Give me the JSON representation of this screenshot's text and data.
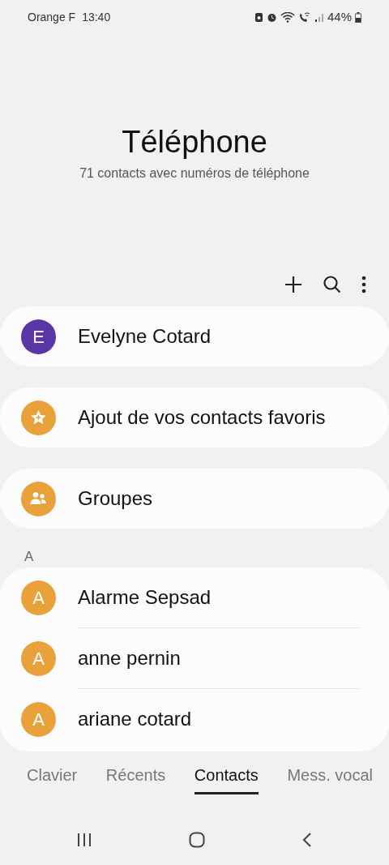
{
  "status_bar": {
    "carrier": "Orange F",
    "time": "13:40",
    "battery": "44%"
  },
  "header": {
    "title": "Téléphone",
    "subtitle": "71 contacts avec numéros de téléphone"
  },
  "profile": {
    "initial": "E",
    "name": "Evelyne Cotard",
    "color": "#5a36a6"
  },
  "shortcuts": [
    {
      "kind": "favorites",
      "label": "Ajout de vos contacts favoris",
      "color": "#e9a23b"
    },
    {
      "kind": "groups",
      "label": "Groupes",
      "color": "#e9a23b"
    }
  ],
  "section": "A",
  "contacts": [
    {
      "initial": "A",
      "name": "Alarme Sepsad",
      "color": "#e9a23b"
    },
    {
      "initial": "A",
      "name": "anne pernin",
      "color": "#e9a23b"
    },
    {
      "initial": "A",
      "name": "ariane cotard",
      "color": "#e9a23b"
    }
  ],
  "tabs": [
    {
      "label": "Clavier",
      "selected": false
    },
    {
      "label": "Récents",
      "selected": false
    },
    {
      "label": "Contacts",
      "selected": true
    },
    {
      "label": "Mess. vocal",
      "selected": false
    }
  ]
}
